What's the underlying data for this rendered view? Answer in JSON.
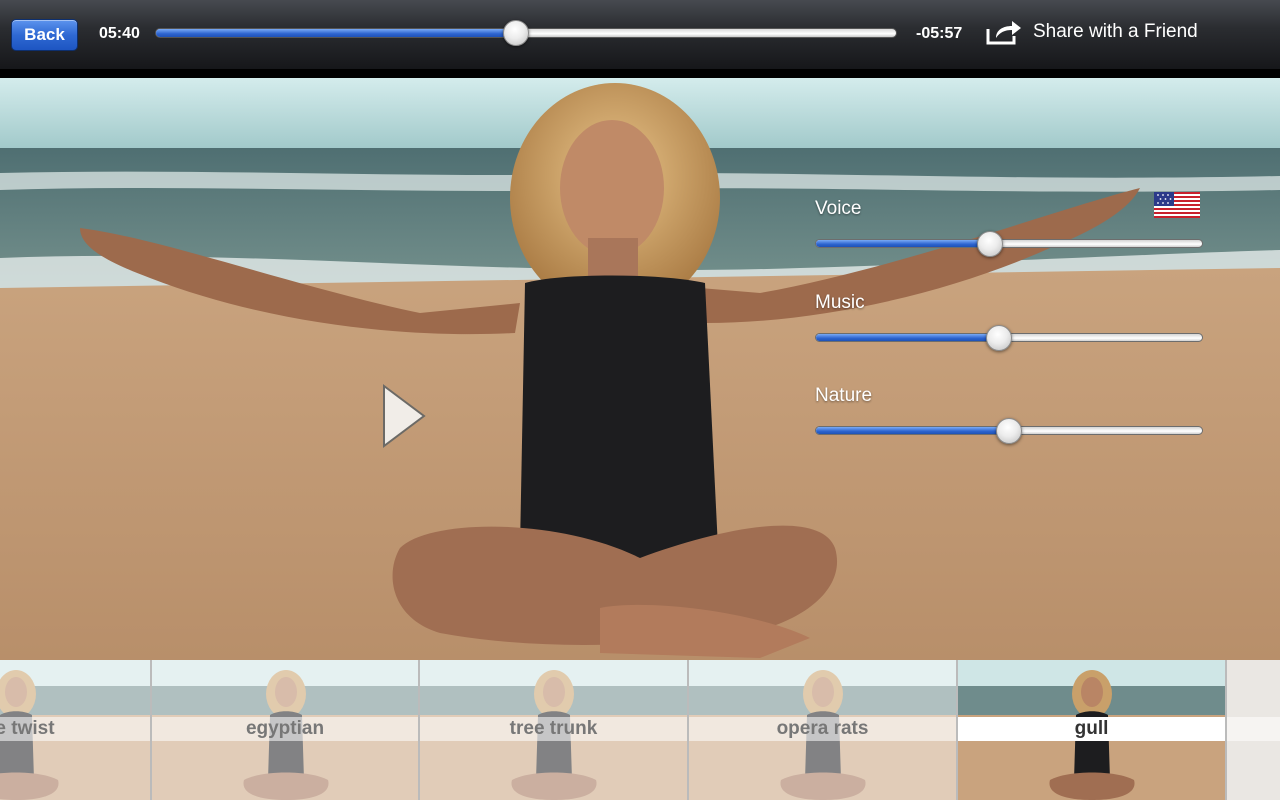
{
  "toolbar": {
    "back_label": "Back",
    "time_elapsed": "05:40",
    "time_remaining": "-05:57",
    "progress": 0.487,
    "share_label": "Share with a Friend"
  },
  "mixer": {
    "language_flag": "us-flag-icon",
    "sliders": [
      {
        "label": "Voice",
        "value": 0.45
      },
      {
        "label": "Music",
        "value": 0.475
      },
      {
        "label": "Nature",
        "value": 0.5
      }
    ]
  },
  "strip": {
    "items": [
      {
        "label": "the twist",
        "selected": false
      },
      {
        "label": "egyptian",
        "selected": false
      },
      {
        "label": "tree trunk",
        "selected": false
      },
      {
        "label": "opera rats",
        "selected": false
      },
      {
        "label": "gull",
        "selected": true
      },
      {
        "label": "",
        "selected": false
      }
    ]
  },
  "colors": {
    "accent_blue": "#2d64d0",
    "sand": "#c6a07a",
    "sea": "#6f8e8e",
    "sky": "#a9cfd0"
  }
}
